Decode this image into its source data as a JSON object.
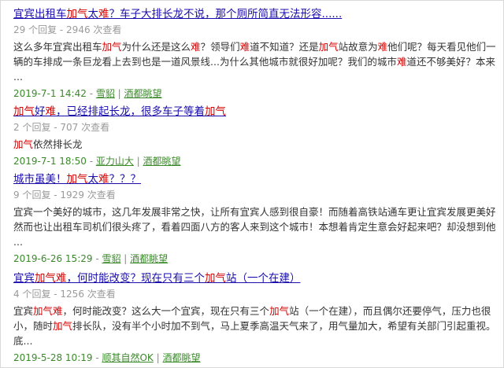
{
  "posts": [
    {
      "title": [
        {
          "t": "宜宾出租车"
        },
        {
          "t": "加气",
          "hl": true
        },
        {
          "t": "太"
        },
        {
          "t": "难",
          "hl": true
        },
        {
          "t": "？车子大排长龙不说，那个厕所简直无法形容......"
        }
      ],
      "meta": "29 个回复 - 2946 次查看",
      "excerpt": [
        [
          {
            "t": "这么多年宜宾出租车"
          },
          {
            "t": "加气",
            "hl": true
          },
          {
            "t": "为什么还是这么"
          },
          {
            "t": "难",
            "hl": true
          },
          {
            "t": "？领导们"
          },
          {
            "t": "难",
            "hl": true
          },
          {
            "t": "道不知道？还是"
          },
          {
            "t": "加气",
            "hl": true
          },
          {
            "t": "站故意为"
          },
          {
            "t": "难",
            "hl": true
          },
          {
            "t": "他们呢？每天看见他们一辆"
          }
        ],
        [
          {
            "t": "辆的车排成一条巨龙看上去到也是一道风景线...为什么其他城市就很好加呢？我们的城市"
          },
          {
            "t": "难",
            "hl": true
          },
          {
            "t": "道还不够美好？本来宜"
          }
        ],
        [
          {
            "t": "..."
          }
        ]
      ],
      "date": "2019-7-1 14:42",
      "author": "雪貂",
      "forum": "酒都眺望"
    },
    {
      "title": [
        {
          "t": "加气",
          "hl": true
        },
        {
          "t": "好"
        },
        {
          "t": "难",
          "hl": true
        },
        {
          "t": "，已经排起长龙，很多车子等着"
        },
        {
          "t": "加气",
          "hl": true
        }
      ],
      "meta": "2 个回复 - 707 次查看",
      "excerpt": [
        [
          {
            "t": "加气",
            "hl": true
          },
          {
            "t": "依然排长龙"
          }
        ]
      ],
      "date": "2019-7-1 18:50",
      "author": "亚力山大",
      "forum": "酒都眺望"
    },
    {
      "title": [
        {
          "t": "城市虽美！"
        },
        {
          "t": "加气",
          "hl": true
        },
        {
          "t": "太"
        },
        {
          "t": "难",
          "hl": true
        },
        {
          "t": "？？？"
        }
      ],
      "meta": "9 个回复 - 1929 次查看",
      "excerpt": [
        [
          {
            "t": "宜宾一个美好的城市，这几年发展非常之快，让所有宜宾人感到很自豪！而随着高铁站通车更让宜宾发展更美好..."
          }
        ],
        [
          {
            "t": "然而也让出租车司机们很头疼了，看着四面八方的客人来到这个城市！本想着肯定生意会好起来吧？却没想到他们"
          }
        ],
        [
          {
            "t": "..."
          }
        ]
      ],
      "date": "2019-6-26 15:29",
      "author": "雪貂",
      "forum": "酒都眺望"
    },
    {
      "title": [
        {
          "t": "宜宾"
        },
        {
          "t": "加气",
          "hl": true
        },
        {
          "t": "难",
          "hl": true
        },
        {
          "t": "，何时能改变？现在只有三个"
        },
        {
          "t": "加气",
          "hl": true
        },
        {
          "t": "站（一个在建）"
        }
      ],
      "meta": "4 个回复 - 1256 次查看",
      "excerpt": [
        [
          {
            "t": "宜宾"
          },
          {
            "t": "加气",
            "hl": true
          },
          {
            "t": "难",
            "hl": true
          },
          {
            "t": "，何时能改变？这么大一个宜宾，现在只有三个"
          },
          {
            "t": "加气",
            "hl": true
          },
          {
            "t": "站（一个在建），而且偶尔还要停气，压力也很"
          }
        ],
        [
          {
            "t": "小，随时"
          },
          {
            "t": "加气",
            "hl": true
          },
          {
            "t": "排长队，没有半个小时加不到气，马上夏季高温天气来了，用气量加大，希望有关部门引起重视。彻"
          }
        ],
        [
          {
            "t": "底..."
          }
        ]
      ],
      "date": "2019-5-28 10:19",
      "author": "顺其自然OK",
      "forum": "酒都眺望"
    }
  ],
  "footer_separator": " - ",
  "footer_divider": " | "
}
